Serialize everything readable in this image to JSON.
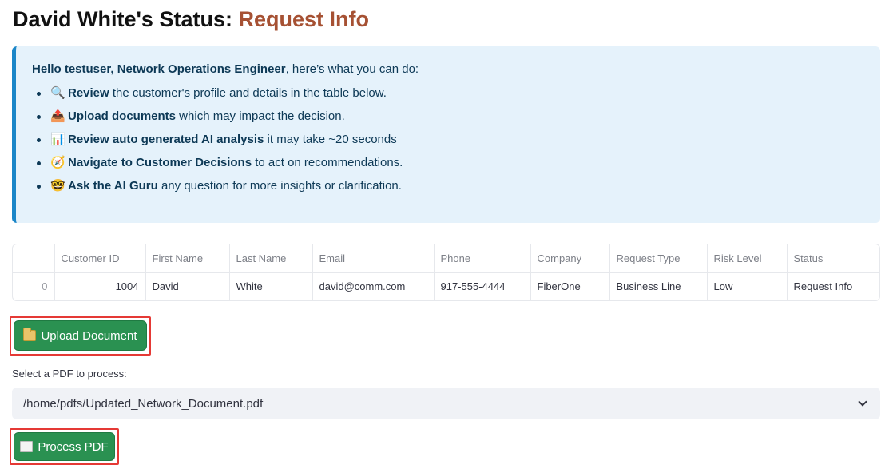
{
  "title": {
    "prefix": "David White's Status: ",
    "status": "Request Info"
  },
  "info": {
    "greeting_bold": "Hello testuser, Network Operations Engineer",
    "greeting_rest": ", here’s what you can do:",
    "items": [
      {
        "icon": "🔍",
        "bold": "Review",
        "rest": " the customer's profile and details in the table below."
      },
      {
        "icon": "📤",
        "bold": "Upload documents",
        "rest": " which may impact the decision."
      },
      {
        "icon": "📊",
        "bold": "Review auto generated AI analysis",
        "rest": " it may take ~20 seconds"
      },
      {
        "icon": "🧭",
        "bold": "Navigate to Customer Decisions",
        "rest": " to act on recommendations."
      },
      {
        "icon": "🤓",
        "bold": "Ask the AI Guru",
        "rest": " any question for more insights or clarification."
      }
    ]
  },
  "table": {
    "headers": [
      "",
      "Customer ID",
      "First Name",
      "Last Name",
      "Email",
      "Phone",
      "Company",
      "Request Type",
      "Risk Level",
      "Status"
    ],
    "rows": [
      [
        "0",
        "1004",
        "David",
        "White",
        "david@comm.com",
        "917-555-4444",
        "FiberOne",
        "Business Line",
        "Low",
        "Request Info"
      ]
    ]
  },
  "upload_button": {
    "label": "Upload Document",
    "icon": "folder-icon"
  },
  "select": {
    "label": "Select a PDF to process:",
    "value": "/home/pdfs/Updated_Network_Document.pdf"
  },
  "process_button": {
    "label": "Process PDF",
    "icon": "document-icon"
  },
  "colors": {
    "status_accent": "#a65133",
    "info_bg": "#e5f2fb",
    "info_border": "#1b86c8",
    "button_green": "#2a9151",
    "highlight_red": "#e53935"
  }
}
